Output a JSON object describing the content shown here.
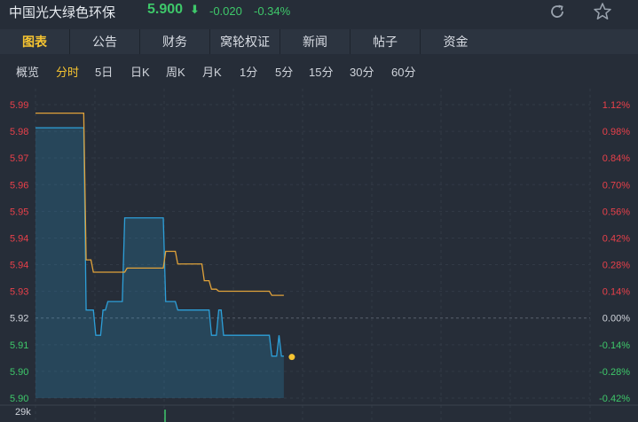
{
  "header": {
    "stock_name": "中国光大绿色环保",
    "price": "5.900",
    "arrow": "⬇",
    "change": "-0.020",
    "change_pct": "-0.34%",
    "icons": [
      "refresh-icon",
      "star-icon"
    ]
  },
  "tabs": [
    {
      "label": "图表",
      "active": true
    },
    {
      "label": "公告"
    },
    {
      "label": "财务"
    },
    {
      "label": "窝轮权证"
    },
    {
      "label": "新闻"
    },
    {
      "label": "帖子"
    },
    {
      "label": "资金"
    }
  ],
  "periods": [
    {
      "label": "概览"
    },
    {
      "label": "分时",
      "active": true
    },
    {
      "label": "5日"
    },
    {
      "label": "日K"
    },
    {
      "label": "周K"
    },
    {
      "label": "月K"
    },
    {
      "label": "1分"
    },
    {
      "label": "5分"
    },
    {
      "label": "15分"
    },
    {
      "label": "30分"
    },
    {
      "label": "60分"
    }
  ],
  "colors": {
    "up": "#e8404a",
    "down": "#3ec86a",
    "price_line": "#2d9fd8",
    "avg_line": "#e0a23a",
    "active": "#f6c431",
    "marker": "#f6c431",
    "volume_bar": "#3ec86a"
  },
  "chart_data": {
    "type": "line",
    "left_axis_labels": [
      "5.99",
      "5.98",
      "5.97",
      "5.96",
      "5.95",
      "5.94",
      "5.94",
      "5.93",
      "5.92",
      "5.91",
      "5.90",
      "5.90"
    ],
    "right_axis_labels": [
      "1.12%",
      "0.98%",
      "0.84%",
      "0.70%",
      "0.56%",
      "0.42%",
      "0.28%",
      "0.14%",
      "0.00%",
      "-0.14%",
      "-0.28%",
      "-0.42%"
    ],
    "reference_price": 5.92,
    "ylim": [
      5.89,
      5.99
    ],
    "volume_label": "29k",
    "series": [
      {
        "key": "price",
        "points": [
          [
            0,
            5.9821
          ],
          [
            20,
            5.9821
          ],
          [
            21,
            5.92
          ],
          [
            24,
            5.92
          ],
          [
            25,
            5.9114
          ],
          [
            27,
            5.9114
          ],
          [
            28,
            5.92
          ],
          [
            29,
            5.92
          ],
          [
            30,
            5.9229
          ],
          [
            36,
            5.9229
          ],
          [
            37,
            5.9514
          ],
          [
            53,
            5.9514
          ],
          [
            54,
            5.9229
          ],
          [
            58,
            5.9229
          ],
          [
            59,
            5.92
          ],
          [
            72,
            5.92
          ],
          [
            73,
            5.9114
          ],
          [
            75,
            5.9114
          ],
          [
            76,
            5.92
          ],
          [
            77,
            5.92
          ],
          [
            78,
            5.9114
          ],
          [
            97,
            5.9114
          ],
          [
            98,
            5.9043
          ],
          [
            100,
            5.9043
          ],
          [
            101,
            5.9114
          ],
          [
            102,
            5.9043
          ],
          [
            103,
            5.9043
          ]
        ]
      },
      {
        "key": "avg",
        "points": [
          [
            0,
            5.9871
          ],
          [
            20,
            5.9871
          ],
          [
            21,
            5.9371
          ],
          [
            23,
            5.9371
          ],
          [
            24,
            5.9329
          ],
          [
            37,
            5.9329
          ],
          [
            38,
            5.9343
          ],
          [
            53,
            5.9343
          ],
          [
            54,
            5.94
          ],
          [
            58,
            5.94
          ],
          [
            59,
            5.9357
          ],
          [
            69,
            5.9357
          ],
          [
            70,
            5.93
          ],
          [
            72,
            5.93
          ],
          [
            73,
            5.9271
          ],
          [
            75,
            5.9271
          ],
          [
            76,
            5.9264
          ],
          [
            97,
            5.9264
          ],
          [
            98,
            5.925
          ],
          [
            103,
            5.925
          ]
        ]
      }
    ],
    "last_point": [
      103,
      5.9043
    ]
  }
}
